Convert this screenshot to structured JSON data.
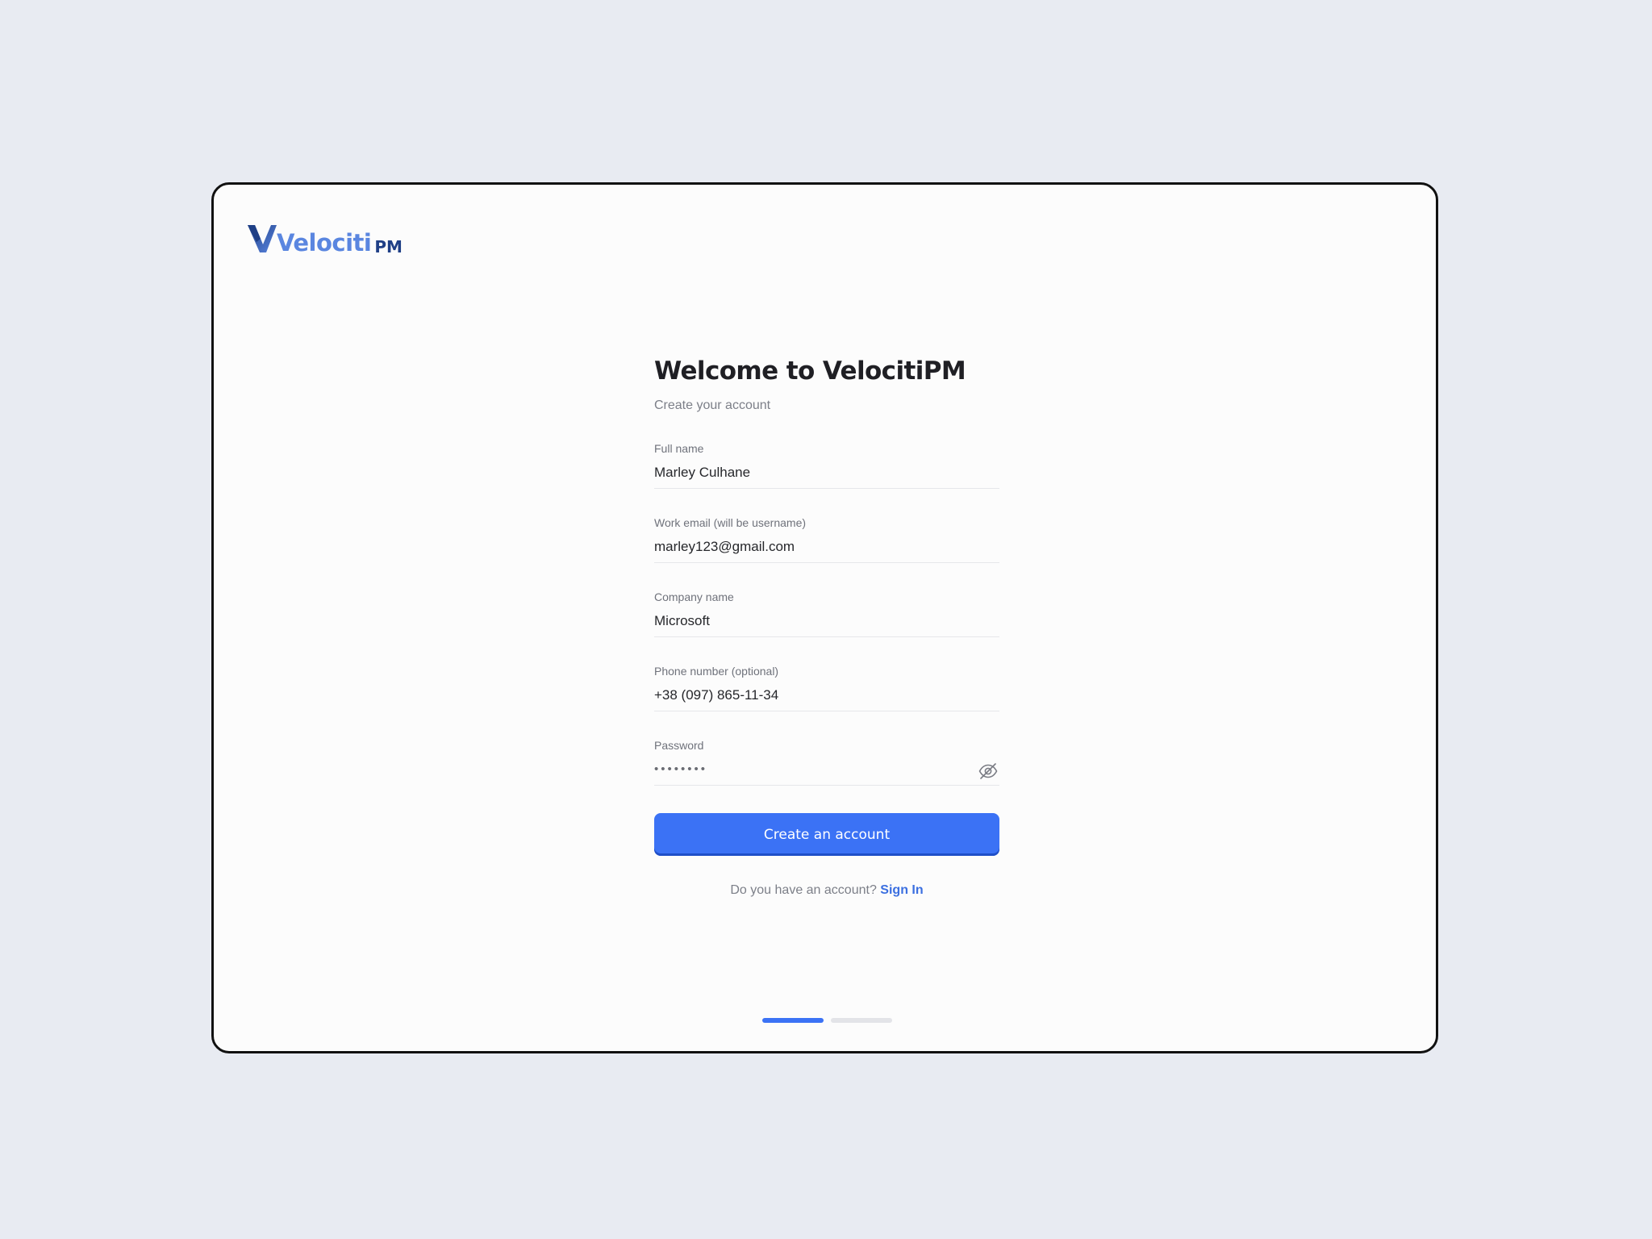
{
  "brand": {
    "name": "Velociti",
    "suffix": "PM",
    "icon": "velociti-v-logo-icon",
    "colors": {
      "primary": "#3b72f5",
      "logo_light": "#5a86e0",
      "logo_dark": "#1f3f86"
    }
  },
  "page": {
    "title": "Welcome to VelocitiPM",
    "subtitle": "Create your account"
  },
  "form": {
    "full_name": {
      "label": "Full name",
      "value": "Marley Culhane"
    },
    "work_email": {
      "label": "Work email (will be username)",
      "value": "marley123@gmail.com"
    },
    "company_name": {
      "label": "Company name",
      "value": "Microsoft"
    },
    "phone_number": {
      "label": "Phone number (optional)",
      "value": "+38 (097) 865-11-34"
    },
    "password": {
      "label": "Password",
      "value": "••••••••",
      "toggle_icon": "eye-off-icon"
    },
    "submit_label": "Create an account"
  },
  "signin": {
    "prompt": "Do you have an account?",
    "link_label": "Sign In"
  },
  "stepper": {
    "current": 1,
    "total": 2
  }
}
